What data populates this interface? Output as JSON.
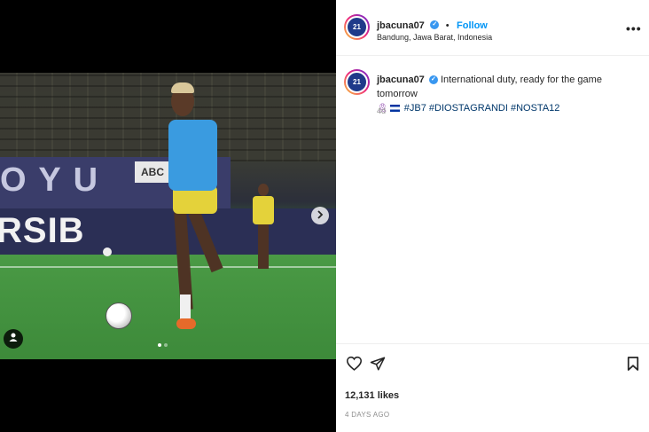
{
  "media": {
    "adboard_text": "RSIB",
    "banner_text": "O Y U",
    "sponsor_text": "ABC",
    "carousel_dots": 2,
    "active_dot": 0
  },
  "header": {
    "username": "jbacuna07",
    "separator": "•",
    "follow_label": "Follow",
    "location": "Bandung, Jawa Barat, Indonesia",
    "more_label": "•••",
    "avatar_text": "21"
  },
  "caption": {
    "username": "jbacuna07",
    "text": "International duty, ready for the game tomorrow",
    "hashtags": "#JB7 #DIOSTAGRANDI #NOSTA12",
    "time_ago": "4d",
    "avatar_text": "21"
  },
  "actions": {
    "likes": "12,131 likes",
    "posted": "4 DAYS AGO"
  },
  "colors": {
    "accent": "#0095f6",
    "verified": "#3897f0",
    "hashtag": "#00376b"
  },
  "icons": [
    "heart-icon",
    "share-icon",
    "bookmark-icon",
    "chevron-right-icon",
    "user-tag-icon",
    "verified-icon",
    "more-icon"
  ]
}
